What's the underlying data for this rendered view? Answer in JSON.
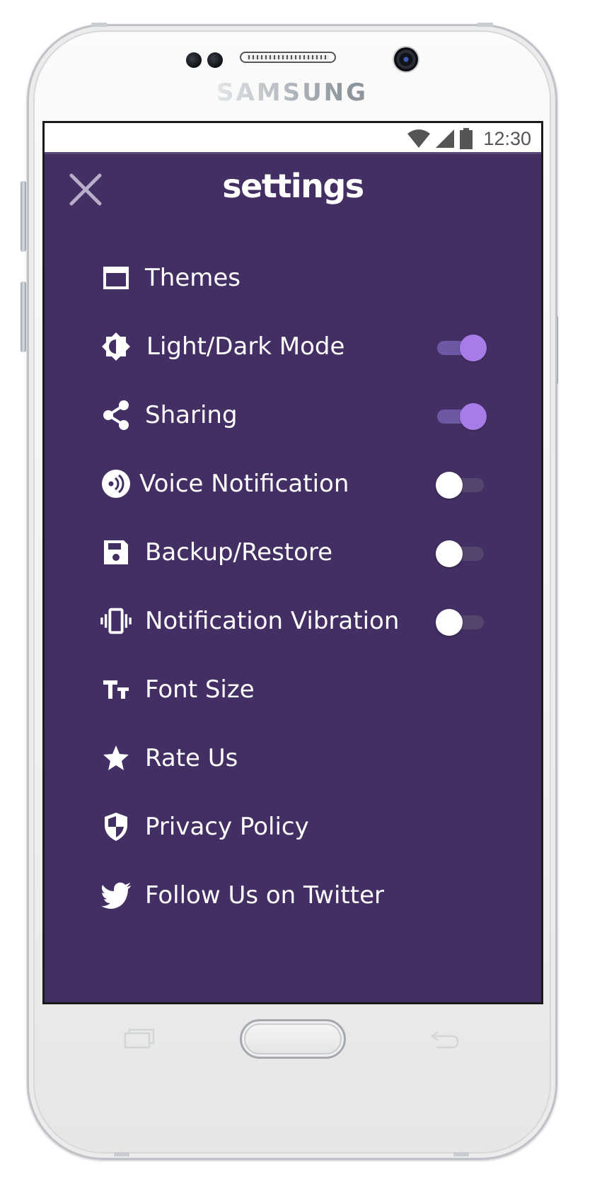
{
  "device": {
    "brand": "SAMSUNG"
  },
  "status_bar": {
    "time": "12:30",
    "icons": [
      "wifi-icon",
      "cell-signal-icon",
      "battery-icon"
    ]
  },
  "header": {
    "title": "settings",
    "close_icon": "close-icon"
  },
  "colors": {
    "screen_background": "#432f63",
    "toggle_on": "#a77ce6",
    "toggle_on_track": "#6e57a3",
    "toggle_off_knob": "#ffffff",
    "toggle_off_track": "#54456f",
    "text": "#ffffff"
  },
  "settings": {
    "items": [
      {
        "label": "Themes",
        "icon": "window-icon"
      },
      {
        "label": "Light/Dark Mode",
        "icon": "brightness-icon",
        "toggle": true,
        "enabled": true
      },
      {
        "label": "Sharing",
        "icon": "share-icon",
        "toggle": true,
        "enabled": true
      },
      {
        "label": "Voice Notification",
        "icon": "voice-icon",
        "toggle": true,
        "enabled": false
      },
      {
        "label": "Backup/Restore",
        "icon": "save-icon",
        "toggle": true,
        "enabled": false
      },
      {
        "label": "Notification Vibration",
        "icon": "vibration-icon",
        "toggle": true,
        "enabled": false
      },
      {
        "label": "Font Size",
        "icon": "font-size-icon"
      },
      {
        "label": "Rate Us",
        "icon": "star-icon"
      },
      {
        "label": "Privacy Policy",
        "icon": "shield-icon"
      },
      {
        "label": "Follow Us on Twitter",
        "icon": "twitter-icon"
      }
    ]
  },
  "nav_bar": {
    "icons": [
      "recent-apps-icon",
      "home-button",
      "back-icon"
    ]
  }
}
